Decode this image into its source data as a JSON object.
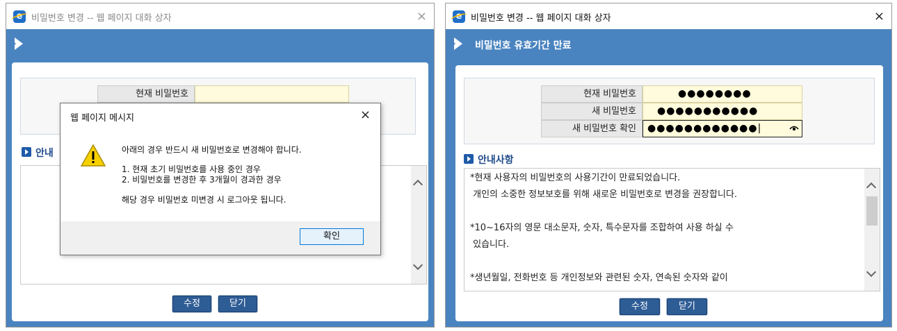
{
  "left": {
    "title": "비밀번호 변경 -- 웹 페이지 대화 상자",
    "close": "×",
    "form": {
      "current_password_label": "현재 비밀번호"
    },
    "section_title": "안내",
    "buttons": {
      "modify": "수정",
      "close": "닫기"
    },
    "dialog": {
      "title": "웹 페이지 메시지",
      "close": "×",
      "message": "아래의 경우 반드시 새 비밀번호로 변경해야 합니다.",
      "items": [
        "1. 현재 초기 비밀번호를 사용 중인 경우",
        "2. 비밀번호를 변경한 후 3개월이 경과한 경우"
      ],
      "footer_message": "해당 경우 비밀번호 미변경 시 로그아웃 됩니다.",
      "ok": "확인"
    }
  },
  "right": {
    "title": "비밀번호 변경 -- 웹 페이지 대화 상자",
    "close": "×",
    "header": "비밀번호 유효기간 만료",
    "form": {
      "current_password_label": "현재 비밀번호",
      "current_password_value": "●●●●●●●●",
      "new_password_label": "새 비밀번호",
      "new_password_value": "●●●●●●●●●●●",
      "confirm_password_label": "새 비밀번호 확인",
      "confirm_password_value": "●●●●●●●●●●●●|"
    },
    "section_title": "안내사항",
    "notice": [
      "*현재 사용자의 비밀번호의 사용기간이 만료되었습니다.",
      " 개인의 소중한 정보보호를 위해 새로운 비밀번호로 변경을 권장합니다.",
      "",
      "*10~16자의 영문 대소문자, 숫자, 특수문자를 조합하여 사용 하실 수",
      " 있습니다.",
      "",
      "*생년월일, 전화번호 등 개인정보와 관련된 숫자, 연속된 숫자와 같이"
    ],
    "buttons": {
      "modify": "수정",
      "close": "닫기"
    }
  }
}
